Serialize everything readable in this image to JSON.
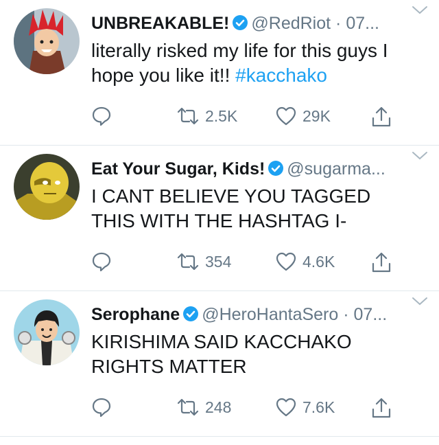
{
  "tweets": [
    {
      "name": "UNBREAKABLE!",
      "handle": "@RedRiot",
      "time": "· 07...",
      "text_before": "literally risked my life for this guys I hope you like it!! ",
      "hashtag": "#kacchako",
      "retweets": "2.5K",
      "likes": "29K",
      "avatar": "red-spiky-hair-character"
    },
    {
      "name": "Eat Your Sugar, Kids!",
      "handle": "@sugarma...",
      "time": "",
      "text_before": "I CANT BELIEVE YOU TAGGED THIS WITH THE HASHTAG I-",
      "hashtag": "",
      "retweets": "354",
      "likes": "4.6K",
      "avatar": "yellow-masked-character"
    },
    {
      "name": "Serophane",
      "handle": "@HeroHantaSero",
      "time": "· 07...",
      "text_before": "KIRISHIMA SAID KACCHAKO RIGHTS MATTER",
      "hashtag": "",
      "retweets": "248",
      "likes": "7.6K",
      "avatar": "black-hair-hero-costume-character"
    }
  ],
  "colors": {
    "link": "#1da1f2",
    "verified": "#1da1f2",
    "secondary_text": "#657786",
    "divider": "#e1e8ed"
  },
  "icons": [
    "reply-icon",
    "retweet-icon",
    "like-icon",
    "share-icon",
    "verified-badge-icon",
    "chevron-down-icon"
  ]
}
